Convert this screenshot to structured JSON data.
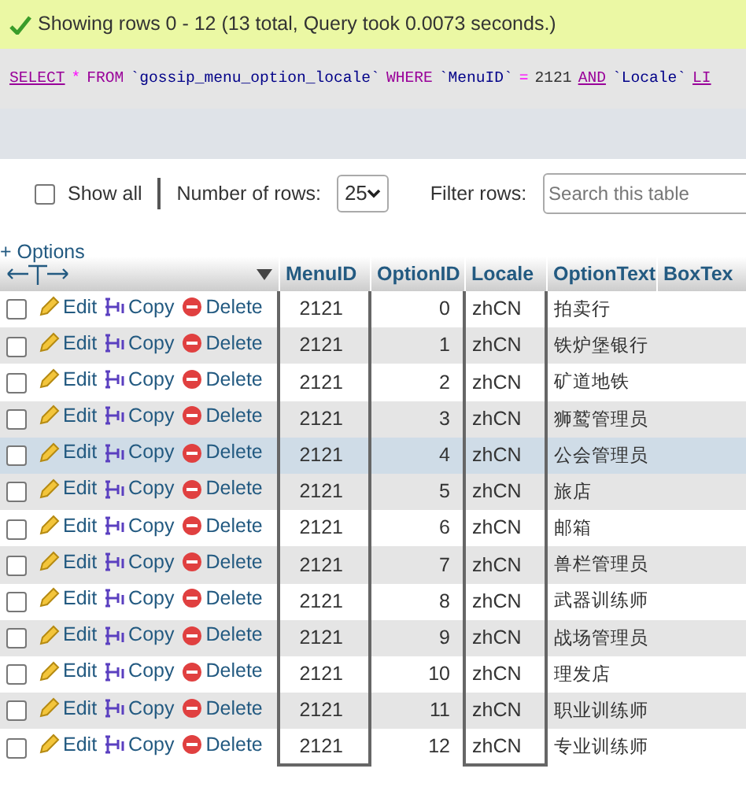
{
  "message": {
    "kind": "success",
    "text": "Showing rows 0 - 12 (13 total, Query took 0.0073 seconds.)"
  },
  "sql": [
    {
      "kind": "keyword",
      "text": "SELECT"
    },
    {
      "kind": "op",
      "text": "*"
    },
    {
      "kind": "keyword2",
      "text": "FROM"
    },
    {
      "kind": "ident",
      "text": "`gossip_menu_option_locale`"
    },
    {
      "kind": "keyword2",
      "text": "WHERE"
    },
    {
      "kind": "ident",
      "text": "`MenuID`"
    },
    {
      "kind": "op",
      "text": "="
    },
    {
      "kind": "number",
      "text": "2121"
    },
    {
      "kind": "keyword",
      "text": "AND"
    },
    {
      "kind": "ident",
      "text": "`Locale`"
    },
    {
      "kind": "keyword",
      "text": "LI"
    }
  ],
  "controls": {
    "show_all": {
      "label": "Show all",
      "checked": false
    },
    "rows_label": "Number of rows:",
    "rows_value": "25",
    "filter_label": "Filter rows:",
    "filter_placeholder": "Search this table"
  },
  "options_link": "+ Options",
  "table": {
    "columns": [
      "MenuID",
      "OptionID",
      "Locale",
      "OptionText",
      "BoxTex"
    ],
    "actions": [
      {
        "edit": "Edit",
        "copy": "Copy",
        "delete": "Delete"
      },
      {
        "edit": "Edit",
        "copy": "Copy",
        "delete": "Delete"
      },
      {
        "edit": "Edit",
        "copy": "Copy",
        "delete": "Delete"
      },
      {
        "edit": "Edit",
        "copy": "Copy",
        "delete": "Delete"
      },
      {
        "edit": "Edit",
        "copy": "Copy",
        "delete": "Delete"
      },
      {
        "edit": "Edit",
        "copy": "Copy",
        "delete": "Delete"
      },
      {
        "edit": "Edit",
        "copy": "Copy",
        "delete": "Delete"
      },
      {
        "edit": "Edit",
        "copy": "Copy",
        "delete": "Delete"
      },
      {
        "edit": "Edit",
        "copy": "Copy",
        "delete": "Delete"
      },
      {
        "edit": "Edit",
        "copy": "Copy",
        "delete": "Delete"
      },
      {
        "edit": "Edit",
        "copy": "Copy",
        "delete": "Delete"
      },
      {
        "edit": "Edit",
        "copy": "Copy",
        "delete": "Delete"
      },
      {
        "edit": "Edit",
        "copy": "Copy",
        "delete": "Delete"
      }
    ],
    "rows": [
      {
        "checked": false,
        "hovered": false,
        "cells": [
          "2121",
          "0",
          "zhCN",
          "拍卖行"
        ]
      },
      {
        "checked": false,
        "hovered": false,
        "cells": [
          "2121",
          "1",
          "zhCN",
          "铁炉堡银行"
        ]
      },
      {
        "checked": false,
        "hovered": false,
        "cells": [
          "2121",
          "2",
          "zhCN",
          "矿道地铁"
        ]
      },
      {
        "checked": false,
        "hovered": false,
        "cells": [
          "2121",
          "3",
          "zhCN",
          "狮鹫管理员"
        ]
      },
      {
        "checked": false,
        "hovered": true,
        "cells": [
          "2121",
          "4",
          "zhCN",
          "公会管理员"
        ]
      },
      {
        "checked": false,
        "hovered": false,
        "cells": [
          "2121",
          "5",
          "zhCN",
          "旅店"
        ]
      },
      {
        "checked": false,
        "hovered": false,
        "cells": [
          "2121",
          "6",
          "zhCN",
          "邮箱"
        ]
      },
      {
        "checked": false,
        "hovered": false,
        "cells": [
          "2121",
          "7",
          "zhCN",
          "兽栏管理员"
        ]
      },
      {
        "checked": false,
        "hovered": false,
        "cells": [
          "2121",
          "8",
          "zhCN",
          "武器训练师"
        ]
      },
      {
        "checked": false,
        "hovered": false,
        "cells": [
          "2121",
          "9",
          "zhCN",
          "战场管理员"
        ]
      },
      {
        "checked": false,
        "hovered": false,
        "cells": [
          "2121",
          "10",
          "zhCN",
          "理发店"
        ]
      },
      {
        "checked": false,
        "hovered": false,
        "cells": [
          "2121",
          "11",
          "zhCN",
          "职业训练师"
        ]
      },
      {
        "checked": false,
        "hovered": false,
        "cells": [
          "2121",
          "12",
          "zhCN",
          "专业训练师"
        ]
      }
    ]
  }
}
